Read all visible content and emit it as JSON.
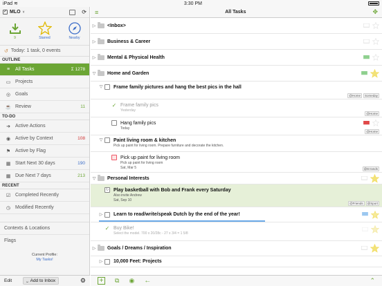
{
  "status": {
    "time": "3:30 PM"
  },
  "sidebar": {
    "app_title": "MLO",
    "quick": [
      {
        "label": "9",
        "icon": "download-arrow-icon"
      },
      {
        "label": "Starred",
        "icon": "star-icon"
      },
      {
        "label": "Nearby",
        "icon": "compass-icon"
      }
    ],
    "today": "Today: 1 task, 0 events",
    "outline_header": "OUTLINE",
    "outline": [
      {
        "label": "All Tasks",
        "count": "Σ 1278"
      },
      {
        "label": "Projects",
        "count": ""
      },
      {
        "label": "Goals",
        "count": ""
      },
      {
        "label": "Review",
        "count": "11"
      }
    ],
    "todo_header": "TO-DO",
    "todo": [
      {
        "label": "Active Actions",
        "count": ""
      },
      {
        "label": "Active by Context",
        "count": "108"
      },
      {
        "label": "Active by Flag",
        "count": ""
      },
      {
        "label": "Start Next 30 days",
        "count": "190"
      },
      {
        "label": "Due Next 7 days",
        "count": "213"
      }
    ],
    "recent_header": "RECENT",
    "recent": [
      {
        "label": "Completed Recently"
      },
      {
        "label": "Modified Recently"
      }
    ],
    "contexts": "Contexts & Locations",
    "flags": "Flags",
    "profile_label": "Current Profile:",
    "profile_name": "My Tasks!",
    "edit": "Edit",
    "add_inbox": "Add to Inbox"
  },
  "main": {
    "title": "All Tasks",
    "rows": [
      {
        "title": "<Inbox>"
      },
      {
        "title": "Business & Career"
      },
      {
        "title": "Mental & Physical Health"
      },
      {
        "title": "Home and Garden"
      },
      {
        "title": "Frame family pictures and hang the best pics in the hall",
        "tags": [
          "@Home",
          "Someday"
        ]
      },
      {
        "title": "Frame family pics",
        "sub": "Yesterday",
        "tags": [
          "@Home"
        ]
      },
      {
        "title": "Hang family pics",
        "sub": "Today",
        "tags": [
          "@Home"
        ]
      },
      {
        "title": "Paint living room & kitchen",
        "sub": "Pick up paint for living room. Prepare furniture and decorate the kitchen."
      },
      {
        "title": "Pick up paint for living room",
        "sub": "Pick up paint for living room",
        "sub2": "Sat, Mar 5",
        "tags": [
          "@Errands"
        ]
      },
      {
        "title": "Personal Interests"
      },
      {
        "title": "Play basketball with Bob and Frank every Saturday",
        "sub": "Also invite Andrew",
        "sub2": "Sat, Sep 10",
        "tags": [
          "@Friends",
          "@Sport"
        ]
      },
      {
        "title": "Learn to read/write/speak Dutch by the end of the year!"
      },
      {
        "title": "Buy Bike!",
        "sub": "Select the model. 700 x 20/28c - 27 x 3/4 = 1 5/8"
      },
      {
        "title": "Goals / Dreams / Inspiration"
      },
      {
        "title": "10,000 Feet: Projects"
      }
    ]
  },
  "colors": {
    "accent": "#6ba534",
    "link": "#3a6cc8",
    "flag_red": "#e04848",
    "flag_green": "#8fd08f",
    "flag_blue": "#9cc8f0",
    "star": "#f2dc5a"
  }
}
